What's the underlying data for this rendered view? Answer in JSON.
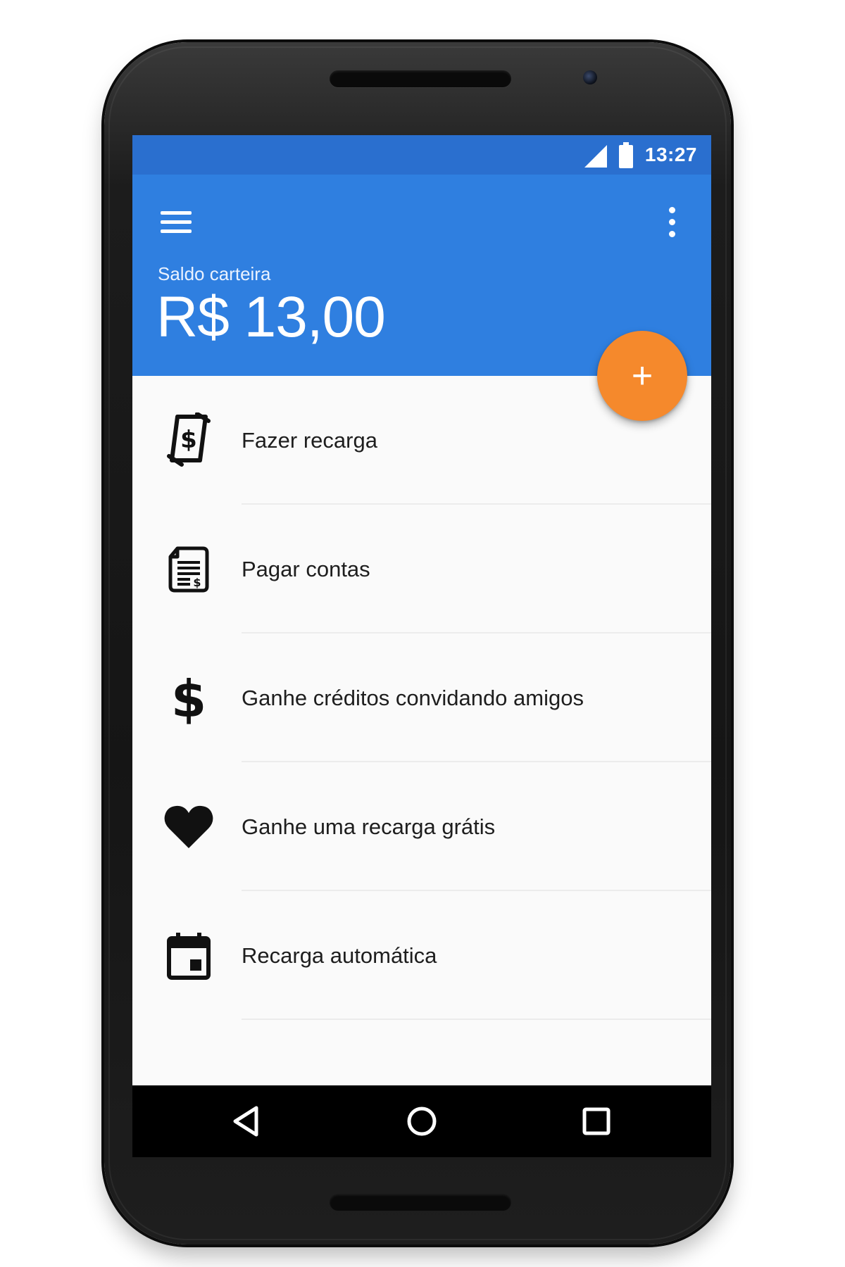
{
  "status_bar": {
    "time": "13:27",
    "icons": [
      "cell-signal-icon",
      "battery-icon"
    ]
  },
  "app_bar": {
    "menu_icon": "hamburger-menu-icon",
    "overflow_icon": "more-vert-icon",
    "balance_label": "Saldo carteira",
    "balance_value": "R$ 13,00"
  },
  "fab": {
    "label": "+",
    "icon": "add-icon"
  },
  "menu_items": [
    {
      "label": "Fazer recarga",
      "icon": "money-transfer-icon"
    },
    {
      "label": "Pagar contas",
      "icon": "bill-document-icon"
    },
    {
      "label": "Ganhe créditos convidando amigos",
      "icon": "dollar-sign-icon"
    },
    {
      "label": "Ganhe uma recarga grátis",
      "icon": "heart-icon"
    },
    {
      "label": "Recarga automática",
      "icon": "calendar-icon"
    }
  ],
  "nav_bar": {
    "icons": [
      "back-icon",
      "home-icon",
      "recents-icon"
    ]
  },
  "colors": {
    "primary": "#2f7fe0",
    "primary_dark": "#2a6fcf",
    "accent": "#f5892c",
    "background": "#fafafa",
    "text": "#1e1e1e"
  }
}
